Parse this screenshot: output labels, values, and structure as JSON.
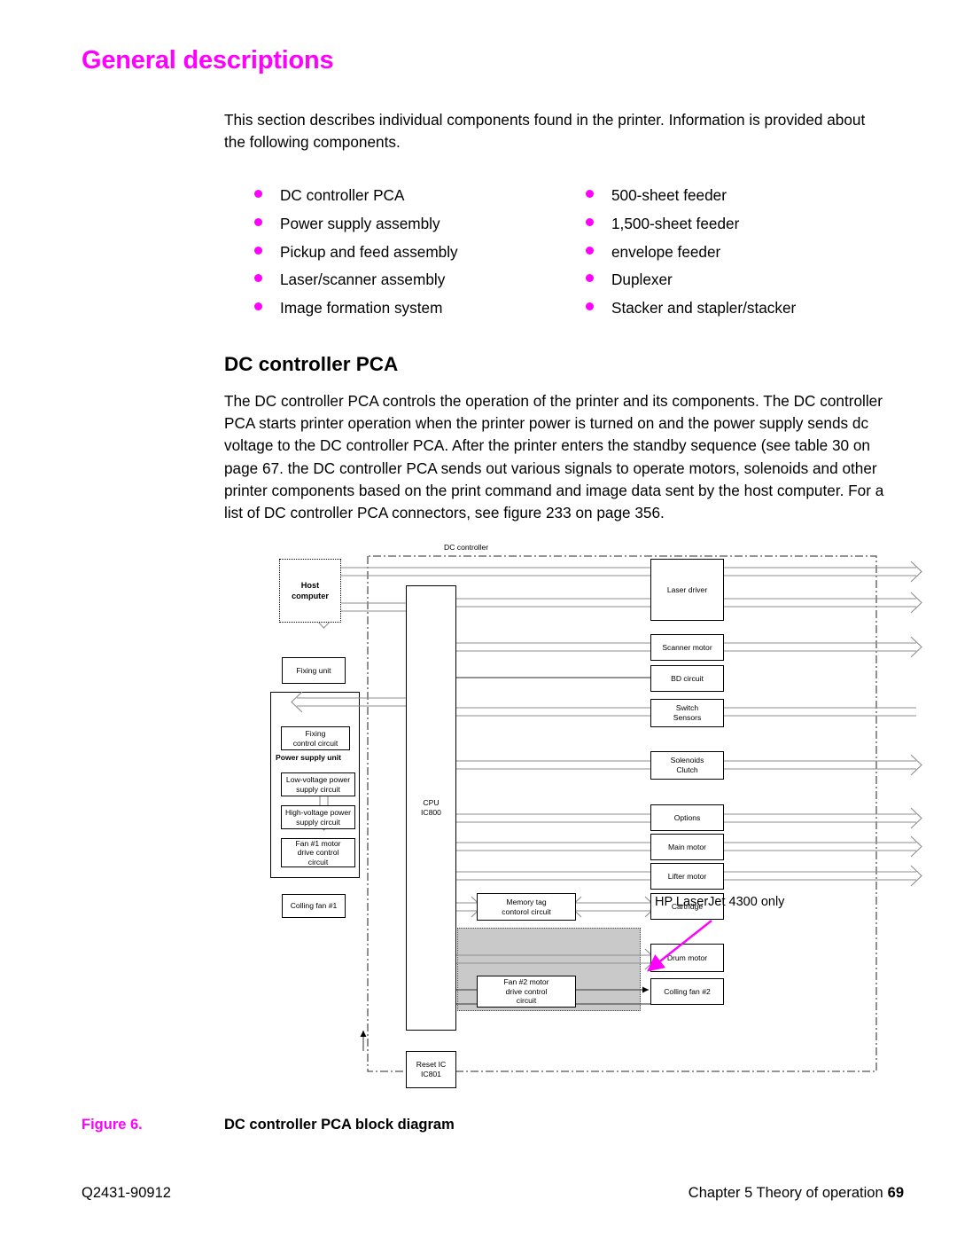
{
  "page": {
    "title": "General descriptions",
    "title_color": "#ff00ff",
    "intro_paragraph": "This section describes individual components found in the printer. Information is provided about the following components.",
    "section_heading": "DC controller PCA",
    "section_paragraph": "The DC controller PCA controls the operation of the printer and its components. The DC controller PCA starts printer operation when the printer power is turned on and the power supply sends dc voltage to the DC controller PCA. After the printer enters the standby sequence (see table 30 on page 67. the DC controller PCA sends out various signals to operate motors, solenoids and other printer components based on the print command and image data sent by the host computer. For a list of DC controller PCA connectors, see figure 233 on page 356."
  },
  "bullets": {
    "bullet_color": "#ff00ff",
    "left_column": [
      "DC controller PCA",
      "Power supply assembly",
      "Pickup and feed assembly",
      "Laser/scanner assembly",
      "Image formation system"
    ],
    "right_column": [
      "500-sheet feeder",
      "1,500-sheet feeder",
      "envelope feeder",
      "Duplexer",
      "Stacker and stapler/stacker"
    ]
  },
  "figure": {
    "caption_number": "Figure 6.",
    "caption_text": "DC controller PCA block diagram",
    "caption_number_color": "#ff00ff",
    "diagram": {
      "boundary_label": "DC controller",
      "callout_label": "HP LaserJet 4300 only",
      "callout_arrow_color": "#ff00ff",
      "host": "Host\ncomputer",
      "cpu": "CPU\nIC800",
      "reset_ic": "Reset IC\nIC801",
      "fixing_unit": "Fixing unit",
      "power_supply_unit_label": "Power supply unit",
      "power_supply_children": [
        "Fixing\ncontrol circuit",
        "Low-voltage power\nsupply circuit",
        "High-voltage power\nsupply circuit",
        "Fan #1 motor\ndrive control\ncircuit"
      ],
      "colling_fan_1": "Colling fan #1",
      "memory_tag": "Memory tag\ncontorol circuit",
      "right_blocks": [
        "Laser driver",
        "Scanner motor",
        "BD circuit",
        "Switch\nSensors",
        "Solenoids\nClutch",
        "Options",
        "Main motor",
        "Lifter motor",
        "Cartridge"
      ],
      "shaded_region": {
        "fill": "#c9c9c9",
        "blocks": [
          "Drum motor",
          "Fan #2 motor\ndrive control\ncircuit",
          "Colling fan #2"
        ]
      }
    }
  },
  "footer": {
    "left": "Q2431-90912",
    "right": "Chapter 5 Theory of operation",
    "page_number": "69"
  }
}
